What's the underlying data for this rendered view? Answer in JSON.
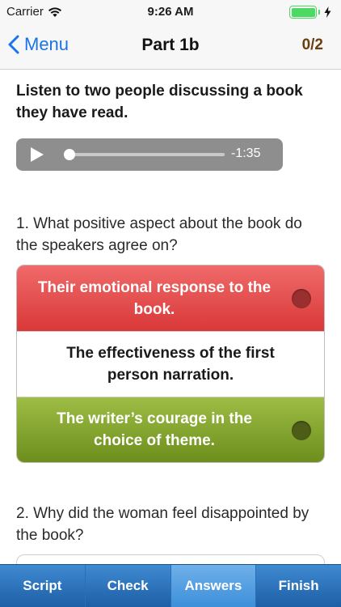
{
  "status_bar": {
    "carrier": "Carrier",
    "time": "9:26 AM",
    "icons": [
      "wifi-icon",
      "battery-icon",
      "charging-icon"
    ]
  },
  "nav": {
    "back_label": "Menu",
    "title": "Part 1b",
    "score": "0/2"
  },
  "instruction": "Listen to two people discussing a book they have read.",
  "audio": {
    "time_remaining": "-1:35",
    "progress": 0.02
  },
  "questions": [
    {
      "text": "1. What positive aspect about the book do the speakers agree on?",
      "answers": [
        {
          "text": "Their emotional response to the book.",
          "state": "wrong"
        },
        {
          "text": "The effectiveness of the first person narration.",
          "state": "neutral"
        },
        {
          "text": "The writer’s courage in the choice of theme.",
          "state": "correct"
        }
      ]
    },
    {
      "text": "2. Why did the woman feel disappointed by the book?"
    }
  ],
  "tabs": [
    {
      "label": "Script",
      "active": false
    },
    {
      "label": "Check",
      "active": false
    },
    {
      "label": "Answers",
      "active": true
    },
    {
      "label": "Finish",
      "active": false
    }
  ],
  "colors": {
    "accent": "#1a73e8",
    "score": "#6b3e0e",
    "wrong": "#e04848",
    "correct": "#85a630",
    "tab_bar": "#2c74bd"
  }
}
